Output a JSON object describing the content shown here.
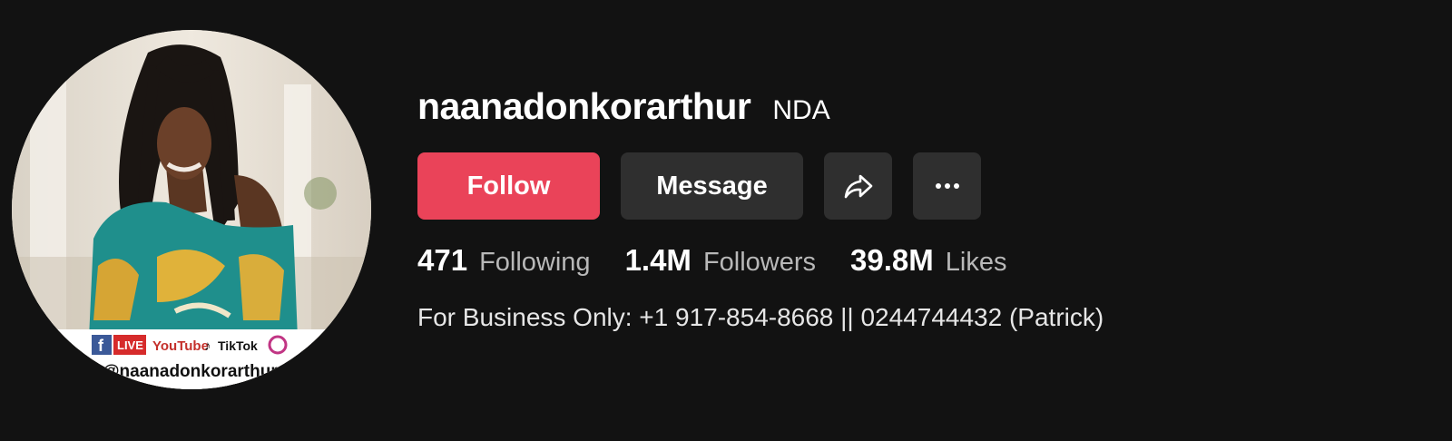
{
  "profile": {
    "username": "naanadonkorarthur",
    "nickname": "NDA",
    "bio": "For Business Only: +1 917-854-8668 || 0244744432 (Patrick)"
  },
  "actions": {
    "follow_label": "Follow",
    "message_label": "Message",
    "share_icon": "share-arrow-icon",
    "more_icon": "more-dots-icon"
  },
  "stats": [
    {
      "value": "471",
      "label": "Following"
    },
    {
      "value": "1.4M",
      "label": "Followers"
    },
    {
      "value": "39.8M",
      "label": "Likes"
    }
  ],
  "avatar": {
    "banner_handle": "@naanadonkorarthur",
    "banner_items": [
      "LIVE",
      "YouTube",
      "TikTok"
    ]
  },
  "colors": {
    "background": "#121212",
    "follow_button": "#ea4359",
    "secondary_button": "#2f2f2f",
    "stat_label": "#b8b8b8"
  }
}
